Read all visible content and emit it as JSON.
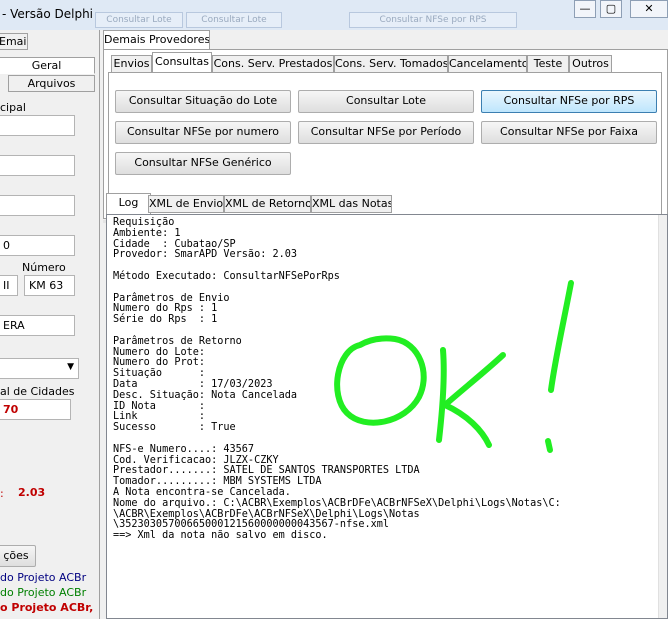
{
  "window": {
    "title": "- Versão Delphi",
    "ghost_buttons": [
      "Consultar Lote",
      "Consultar Lote",
      "Consultar NFSe por RPS"
    ],
    "controls": {
      "minimize": "—",
      "maximize": "▢",
      "close": "✕"
    }
  },
  "left": {
    "tab_email": "Email",
    "tab_geral": "Geral",
    "tab_arquivos": "Arquivos",
    "label_municipal": "cipal",
    "label_numero": "Número",
    "field_zero": "0",
    "field_ii": "II",
    "field_km": "KM 63",
    "field_era": "ERA",
    "label_cidades": "al de Cidades",
    "value_70": "70",
    "value_version": "2.03",
    "colon": ":",
    "button_config": "ções",
    "footer_lines": [
      {
        "text": "do Projeto ACBr",
        "color": "#000080"
      },
      {
        "text": "do Projeto ACBr",
        "color": "#008000"
      },
      {
        "text": "o Projeto ACBr,",
        "color": "#c00000"
      }
    ]
  },
  "right": {
    "group_title": "Demais Provedores",
    "tabs": [
      "Envios",
      "Consultas",
      "Cons. Serv. Prestados",
      "Cons. Serv. Tomados",
      "Cancelamento",
      "Teste",
      "Outros"
    ],
    "buttons": {
      "situacao_lote": "Consultar Situação do Lote",
      "lote": "Consultar Lote",
      "nfse_rps": "Consultar NFSe por RPS",
      "nfse_numero": "Consultar NFSe por numero",
      "nfse_periodo": "Consultar NFSe por Período",
      "nfse_faixa": "Consultar NFSe por Faixa",
      "nfse_generico": "Consultar NFSe Genérico"
    },
    "log_tabs": [
      "Log",
      "XML de Envio",
      "XML de Retorno",
      "XML das Notas"
    ],
    "log_text": "Requisição\nAmbiente: 1\nCidade  : Cubatao/SP\nProvedor: SmarAPD Versão: 2.03\n\nMétodo Executado: ConsultarNFSePorRps\n\nParâmetros de Envio\nNumero do Rps : 1\nSérie do Rps  : 1\n\nParâmetros de Retorno\nNumero do Lote:\nNumero do Prot:\nSituação      :\nData          : 17/03/2023\nDesc. Situação: Nota Cancelada\nID Nota       :\nLink          :\nSucesso       : True\n\nNFS-e Numero....: 43567\nCod. Verificacao: JLZX-CZKY\nPrestador.......: SATEL DE SANTOS TRANSPORTES LTDA\nTomador.........: MBM SYSTEMS LTDA\nA Nota encontra-se Cancelada.\nNome do arquivo.: C:\\ACBR\\Exemplos\\ACBrDFe\\ACBrNFSeX\\Delphi\\Logs\\Notas\\C:\n\\ACBR\\Exemplos\\ACBrDFe\\ACBrNFSeX\\Delphi\\Logs\\Notas\n\\35230305700665000121560000000043567-nfse.xml\n==> Xml da nota não salvo em disco.",
    "handwriting": "ok!",
    "handwriting_color": "#22ee22"
  }
}
